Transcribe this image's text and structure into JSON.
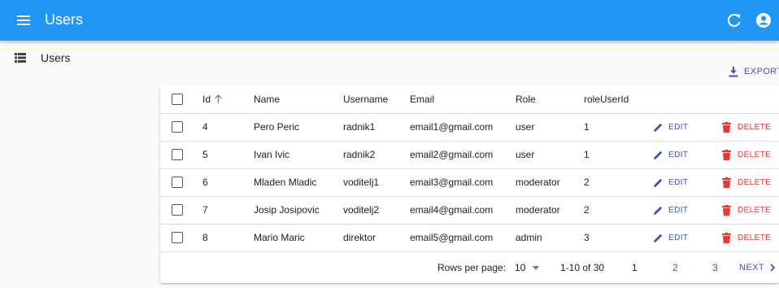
{
  "appbar": {
    "title": "Users"
  },
  "sidebar": {
    "items": [
      {
        "label": "Users"
      }
    ]
  },
  "toolbar": {
    "export_label": "EXPORT"
  },
  "table": {
    "columns": {
      "id": "Id",
      "name": "Name",
      "username": "Username",
      "email": "Email",
      "role": "Role",
      "roleUserId": "roleUserId"
    },
    "edit_label": "EDIT",
    "delete_label": "DELETE",
    "rows": [
      {
        "id": "4",
        "name": "Pero Peric",
        "username": "radnik1",
        "email": "email1@gmail.com",
        "role": "user",
        "roleUserId": "1"
      },
      {
        "id": "5",
        "name": "Ivan Ivic",
        "username": "radnik2",
        "email": "email2@gmail.com",
        "role": "user",
        "roleUserId": "1"
      },
      {
        "id": "6",
        "name": "Mladen Mladic",
        "username": "voditelj1",
        "email": "email3@gmail.com",
        "role": "moderator",
        "roleUserId": "2"
      },
      {
        "id": "7",
        "name": "Josip Josipovic",
        "username": "voditelj2",
        "email": "email4@gmail.com",
        "role": "moderator",
        "roleUserId": "2"
      },
      {
        "id": "8",
        "name": "Mario Maric",
        "username": "direktor",
        "email": "email5@gmail.com",
        "role": "admin",
        "roleUserId": "3"
      }
    ]
  },
  "pagination": {
    "rows_per_page_label": "Rows per page:",
    "rows_per_page_value": "10",
    "range": "1-10 of 30",
    "pages": [
      "1",
      "2",
      "3"
    ],
    "next_label": "NEXT"
  }
}
